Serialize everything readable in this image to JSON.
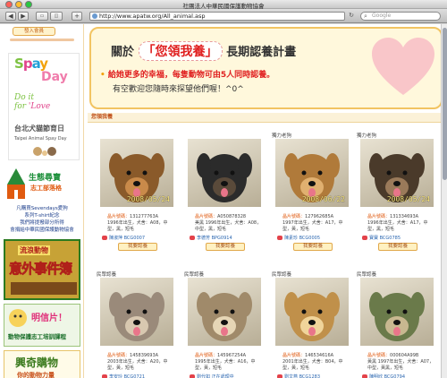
{
  "window": {
    "title": "社團法人中華民國保護動物協會"
  },
  "toolbar": {
    "back": "◀",
    "forward": "▶",
    "add": "+",
    "url": "http://www.apatw.org/All_animal.asp",
    "reload": "↻",
    "search_placeholder": "Google"
  },
  "sidebar": {
    "join_label": "發入會員",
    "spay": {
      "w1": "S",
      "w2": "p",
      "w3": "a",
      "w4": "y",
      "w5": "Day",
      "doit1": "Do it",
      "doit2": "for ",
      "doit_love": "'Love",
      "cn": "台北犬貓節育日",
      "en": "Taipei Animal Spay Day"
    },
    "eco": {
      "title": "生態尋寶",
      "sub": "志工部落格"
    },
    "promo_lines": [
      "凡購買Sevendays愛狗",
      "系列T-shirt紀念",
      "我們將提撥部分所得",
      "會捐給中華民國保護動物協會"
    ],
    "accident": {
      "top": "流浪動物",
      "main": "意外事件簿",
      "foot": ""
    },
    "postcard": {
      "title": "明信片！",
      "sub": "動物保護志工培訓課程"
    },
    "shop": {
      "title": "興奇購物",
      "sub": "你的動物力量"
    }
  },
  "banner": {
    "pre": "關於",
    "hl": "「您領我養」",
    "post": "長期認養計畫",
    "line1": "給她更多的幸福，每隻動物可由5人同時認養。",
    "line2": "有空歡迎您隨時來探望他們喔！^0^"
  },
  "section": {
    "title": "您領我養"
  },
  "adopt_label": "我要認養",
  "animals": [
    {
      "status": "",
      "date": "2008/05/24",
      "photo_no": "131277763A",
      "info": "1996年出生，犬舍：A08，中型，黑，短毛",
      "owner": "陳淑萍 BCG0007"
    },
    {
      "status": "",
      "date": "",
      "photo_no": "A050878328",
      "info": "美黑 1996年出生，犬舍：A08，中型，黑，短毛",
      "owner": "李德芳 BPG0914"
    },
    {
      "status": "獨力老狗",
      "date": "2008/06/22",
      "photo_no": "127962685A",
      "info": "1997年出生，犬舍：A17，中型，黃，短毛",
      "owner": "陳素珍 BCG0005"
    },
    {
      "status": "獨力老狗",
      "date": "2008/05/24",
      "photo_no": "131334693A",
      "info": "1996年出生，犬舍：A17，中型，黑，短毛",
      "owner": "寶寶 BCG0785"
    },
    {
      "status": "民眾認養",
      "date": "",
      "photo_no": "145839693A",
      "info": "2003年出生，犬舍：A20，中型，黃，短毛",
      "owner": "李安玲 BCG0721"
    },
    {
      "status": "民眾認養",
      "date": "",
      "photo_no": "145967254A",
      "info": "1995年出生，犬舍：A16，中型，黃，短毛",
      "owner": "劉代如 正在處理中"
    },
    {
      "status": "民眾認養",
      "date": "",
      "photo_no": "146534616A",
      "info": "2001年出生，犬舍：B04，中型，黃，短毛",
      "owner": "劉文燕 BCG1283"
    },
    {
      "status": "民眾認養",
      "date": "",
      "photo_no": "000604A99B",
      "info": "黃黑 1997年出生，犬舍：A07，中型，黃黑，短毛",
      "owner": "陳明欣 BCG0794"
    }
  ],
  "photo_label": "晶片號碼：",
  "colors": {
    "accent": "#f2c462",
    "red": "#e02020",
    "button": "#fff1c2",
    "sidebar_green": "#1c8f3a"
  },
  "icons": [
    "globe-icon",
    "search-icon",
    "paw-icon",
    "heart-icon"
  ]
}
